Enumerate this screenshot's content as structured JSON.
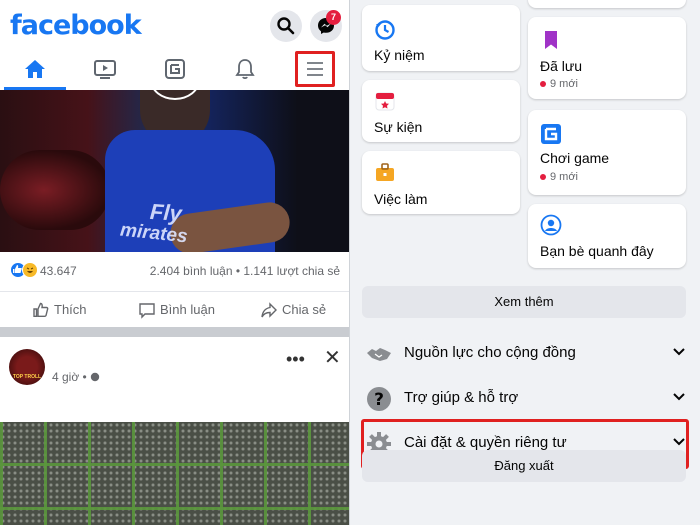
{
  "left": {
    "logo": "facebook",
    "messenger_badge": "7",
    "tabs": [
      {
        "icon": "home-icon",
        "active": true
      },
      {
        "icon": "watch-video-icon",
        "active": false
      },
      {
        "icon": "gaming-icon",
        "active": false
      },
      {
        "icon": "bell-icon",
        "active": false
      },
      {
        "icon": "hamburger-menu-icon",
        "active": false
      }
    ],
    "video": {
      "shirt_text_1": "Fly",
      "shirt_text_2": "mirates"
    },
    "post1": {
      "reactions_count": "43.647",
      "comments_shares": "2.404 bình luận • 1.141 lượt chia sẻ",
      "like_label": "Thích",
      "comment_label": "Bình luận",
      "share_label": "Chia sẻ"
    },
    "post2": {
      "avatar_text": "TOP TROLL",
      "time": "4 giờ •",
      "more": "•••",
      "close": "✕"
    }
  },
  "right": {
    "left_cards": [
      {
        "label": "Kỷ niệm",
        "icon": "memories-clock-icon"
      },
      {
        "label": "Sự kiện",
        "icon": "events-calendar-icon"
      },
      {
        "label": "Việc làm",
        "icon": "jobs-briefcase-icon"
      }
    ],
    "right_cards": [
      {
        "label": "Đã lưu",
        "sub": "9 mới",
        "icon": "saved-bookmark-icon"
      },
      {
        "label": "Chơi game",
        "sub": "9 mới",
        "icon": "gaming-icon"
      },
      {
        "label": "Bạn bè quanh đây",
        "sub": "",
        "icon": "nearby-friends-icon"
      }
    ],
    "see_more": "Xem thêm",
    "sections": [
      {
        "label": "Nguồn lực cho cộng đồng",
        "icon": "community-handshake-icon"
      },
      {
        "label": "Trợ giúp & hỗ trợ",
        "icon": "help-question-icon"
      },
      {
        "label": "Cài đặt & quyền riêng tư",
        "icon": "settings-gear-icon"
      }
    ],
    "logout": "Đăng xuất"
  },
  "colors": {
    "brand": "#1877f2",
    "highlight": "#e02020",
    "badge": "#e41e3f"
  }
}
